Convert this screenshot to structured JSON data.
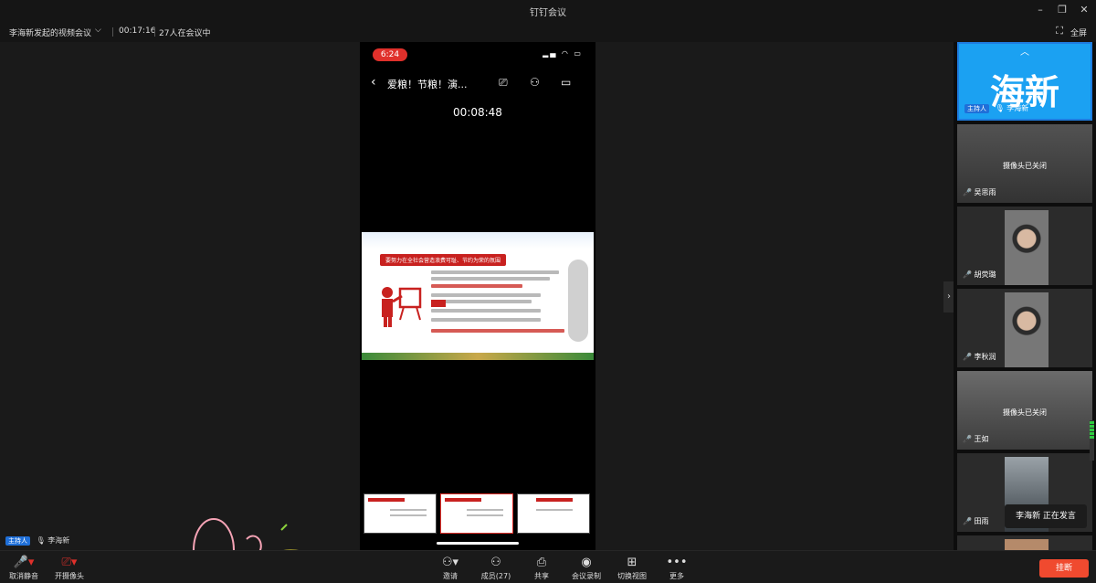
{
  "window": {
    "title": "钉钉会议",
    "controls": [
      "minimize",
      "restore",
      "close"
    ]
  },
  "infobar": {
    "meeting_name": "李海新发起的视频会议",
    "duration": "00:17:16",
    "participants_in_meeting": "27人在会议中",
    "fullscreen_label": "全屏"
  },
  "phone": {
    "status_time": "6:24",
    "title": "爱粮！节粮！演...",
    "timer": "00:08:48"
  },
  "slide": {
    "banner": "要努力在全社会营造浪费可耻、节约为荣的氛围"
  },
  "stage_host": {
    "tag": "主持人",
    "name": "李海新"
  },
  "sidebar": {
    "host_tile": {
      "display": "海新",
      "tag": "主持人",
      "name": "李海新"
    },
    "tiles": [
      {
        "name": "吴思雨",
        "status": "摄像头已关闭"
      },
      {
        "name": "胡荧璐",
        "status": ""
      },
      {
        "name": "李秋润",
        "status": ""
      },
      {
        "name": "王如",
        "status": "摄像头已关闭"
      },
      {
        "name": "田雨",
        "status": ""
      }
    ],
    "speaking": "李海新  正在发言"
  },
  "toolbar": {
    "unmute": "取消静音",
    "camera": "开摄像头",
    "invite": "邀请",
    "members": "成员(27)",
    "share": "共享",
    "record": "会议录制",
    "switch_view": "切换视图",
    "more": "更多",
    "hangup": "挂断"
  }
}
